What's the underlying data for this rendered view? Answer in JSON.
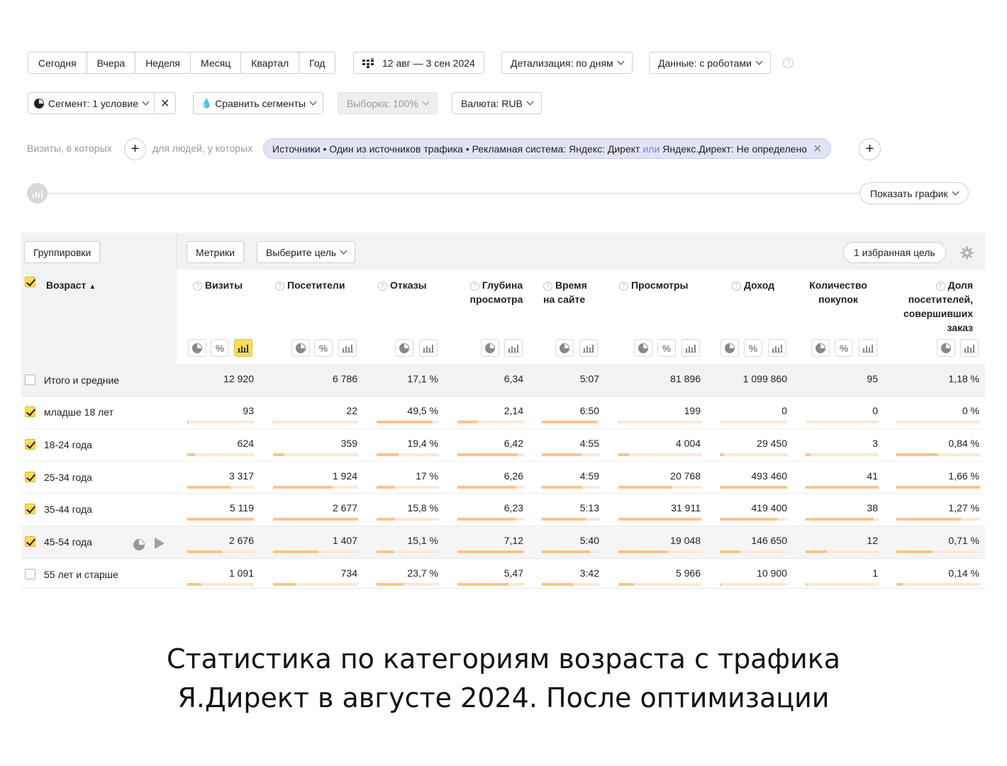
{
  "period_buttons": [
    "Сегодня",
    "Вчера",
    "Неделя",
    "Месяц",
    "Квартал",
    "Год"
  ],
  "date_range": "12 авг — 3 сен 2024",
  "detail": "Детализация: по дням",
  "data_mode": "Данные: с роботами",
  "segment": "Сегмент: 1 условие",
  "compare": "Сравнить сегменты",
  "sample": "Выборка: 100%",
  "currency": "Валюта: RUB",
  "filter": {
    "visits_label": "Визиты, в которых",
    "people_label": "для людей, у которых",
    "pill_text": "Источники • Один из источников трафика • Рекламная система: Яндекс: Директ",
    "pill_or": "или",
    "pill_text2": "Яндекс.Директ: Не определено"
  },
  "show_chart": "Показать график",
  "toolbar": {
    "groupings": "Группировки",
    "metrics": "Метрики",
    "choose_goal": "Выберите цель",
    "favorite_goal": "1 избранная цель"
  },
  "dimension_header": "Возраст",
  "columns": [
    "Визиты",
    "Посетители",
    "Отказы",
    "Глубина просмотра",
    "Время на сайте",
    "Просмотры",
    "Доход",
    "Количество покупок",
    "Доля посетителей, совершивших заказ"
  ],
  "rows": [
    {
      "label": "Итого и средние",
      "checked": false,
      "values": [
        "12 920",
        "6 786",
        "17,1 %",
        "6,34",
        "5:07",
        "81 896",
        "1 099 860",
        "95",
        "1,18 %"
      ]
    },
    {
      "label": "младше 18 лет",
      "checked": true,
      "values": [
        "93",
        "22",
        "49,5 %",
        "2,14",
        "6:50",
        "199",
        "0",
        "0",
        "0 %"
      ]
    },
    {
      "label": "18-24 года",
      "checked": true,
      "values": [
        "624",
        "359",
        "19,4 %",
        "6,42",
        "4:55",
        "4 004",
        "29 450",
        "3",
        "0,84 %"
      ]
    },
    {
      "label": "25-34 года",
      "checked": true,
      "values": [
        "3 317",
        "1 924",
        "17 %",
        "6,26",
        "4:59",
        "20 768",
        "493 460",
        "41",
        "1,66 %"
      ]
    },
    {
      "label": "35-44 года",
      "checked": true,
      "values": [
        "5 119",
        "2 677",
        "15,8 %",
        "6,23",
        "5:13",
        "31 911",
        "419 400",
        "38",
        "1,27 %"
      ]
    },
    {
      "label": "45-54 года",
      "checked": true,
      "values": [
        "2 676",
        "1 407",
        "15,1 %",
        "7,12",
        "5:40",
        "19 048",
        "146 650",
        "12",
        "0,71 %"
      ]
    },
    {
      "label": "55 лет и старше",
      "checked": false,
      "values": [
        "1 091",
        "734",
        "23,7 %",
        "5,47",
        "3:42",
        "5 966",
        "10 900",
        "1",
        "0,14 %"
      ]
    }
  ],
  "row_bars": [
    [
      0.02,
      0.01,
      0.9,
      0.3,
      0.95,
      0.01,
      0.0,
      0.0,
      0.0
    ],
    [
      0.12,
      0.13,
      0.35,
      0.9,
      0.68,
      0.13,
      0.06,
      0.07,
      0.5
    ],
    [
      0.65,
      0.7,
      0.3,
      0.88,
      0.7,
      0.65,
      1.0,
      1.0,
      1.0
    ],
    [
      1.0,
      1.0,
      0.29,
      0.87,
      0.75,
      1.0,
      0.85,
      0.93,
      0.77
    ],
    [
      0.52,
      0.53,
      0.27,
      1.0,
      0.83,
      0.6,
      0.3,
      0.29,
      0.43
    ],
    [
      0.21,
      0.27,
      0.43,
      0.77,
      0.54,
      0.19,
      0.02,
      0.02,
      0.08
    ]
  ],
  "caption": [
    "Статистика по категориям возраста с трафика",
    "Я.Директ в августе 2024. После оптимизации"
  ]
}
